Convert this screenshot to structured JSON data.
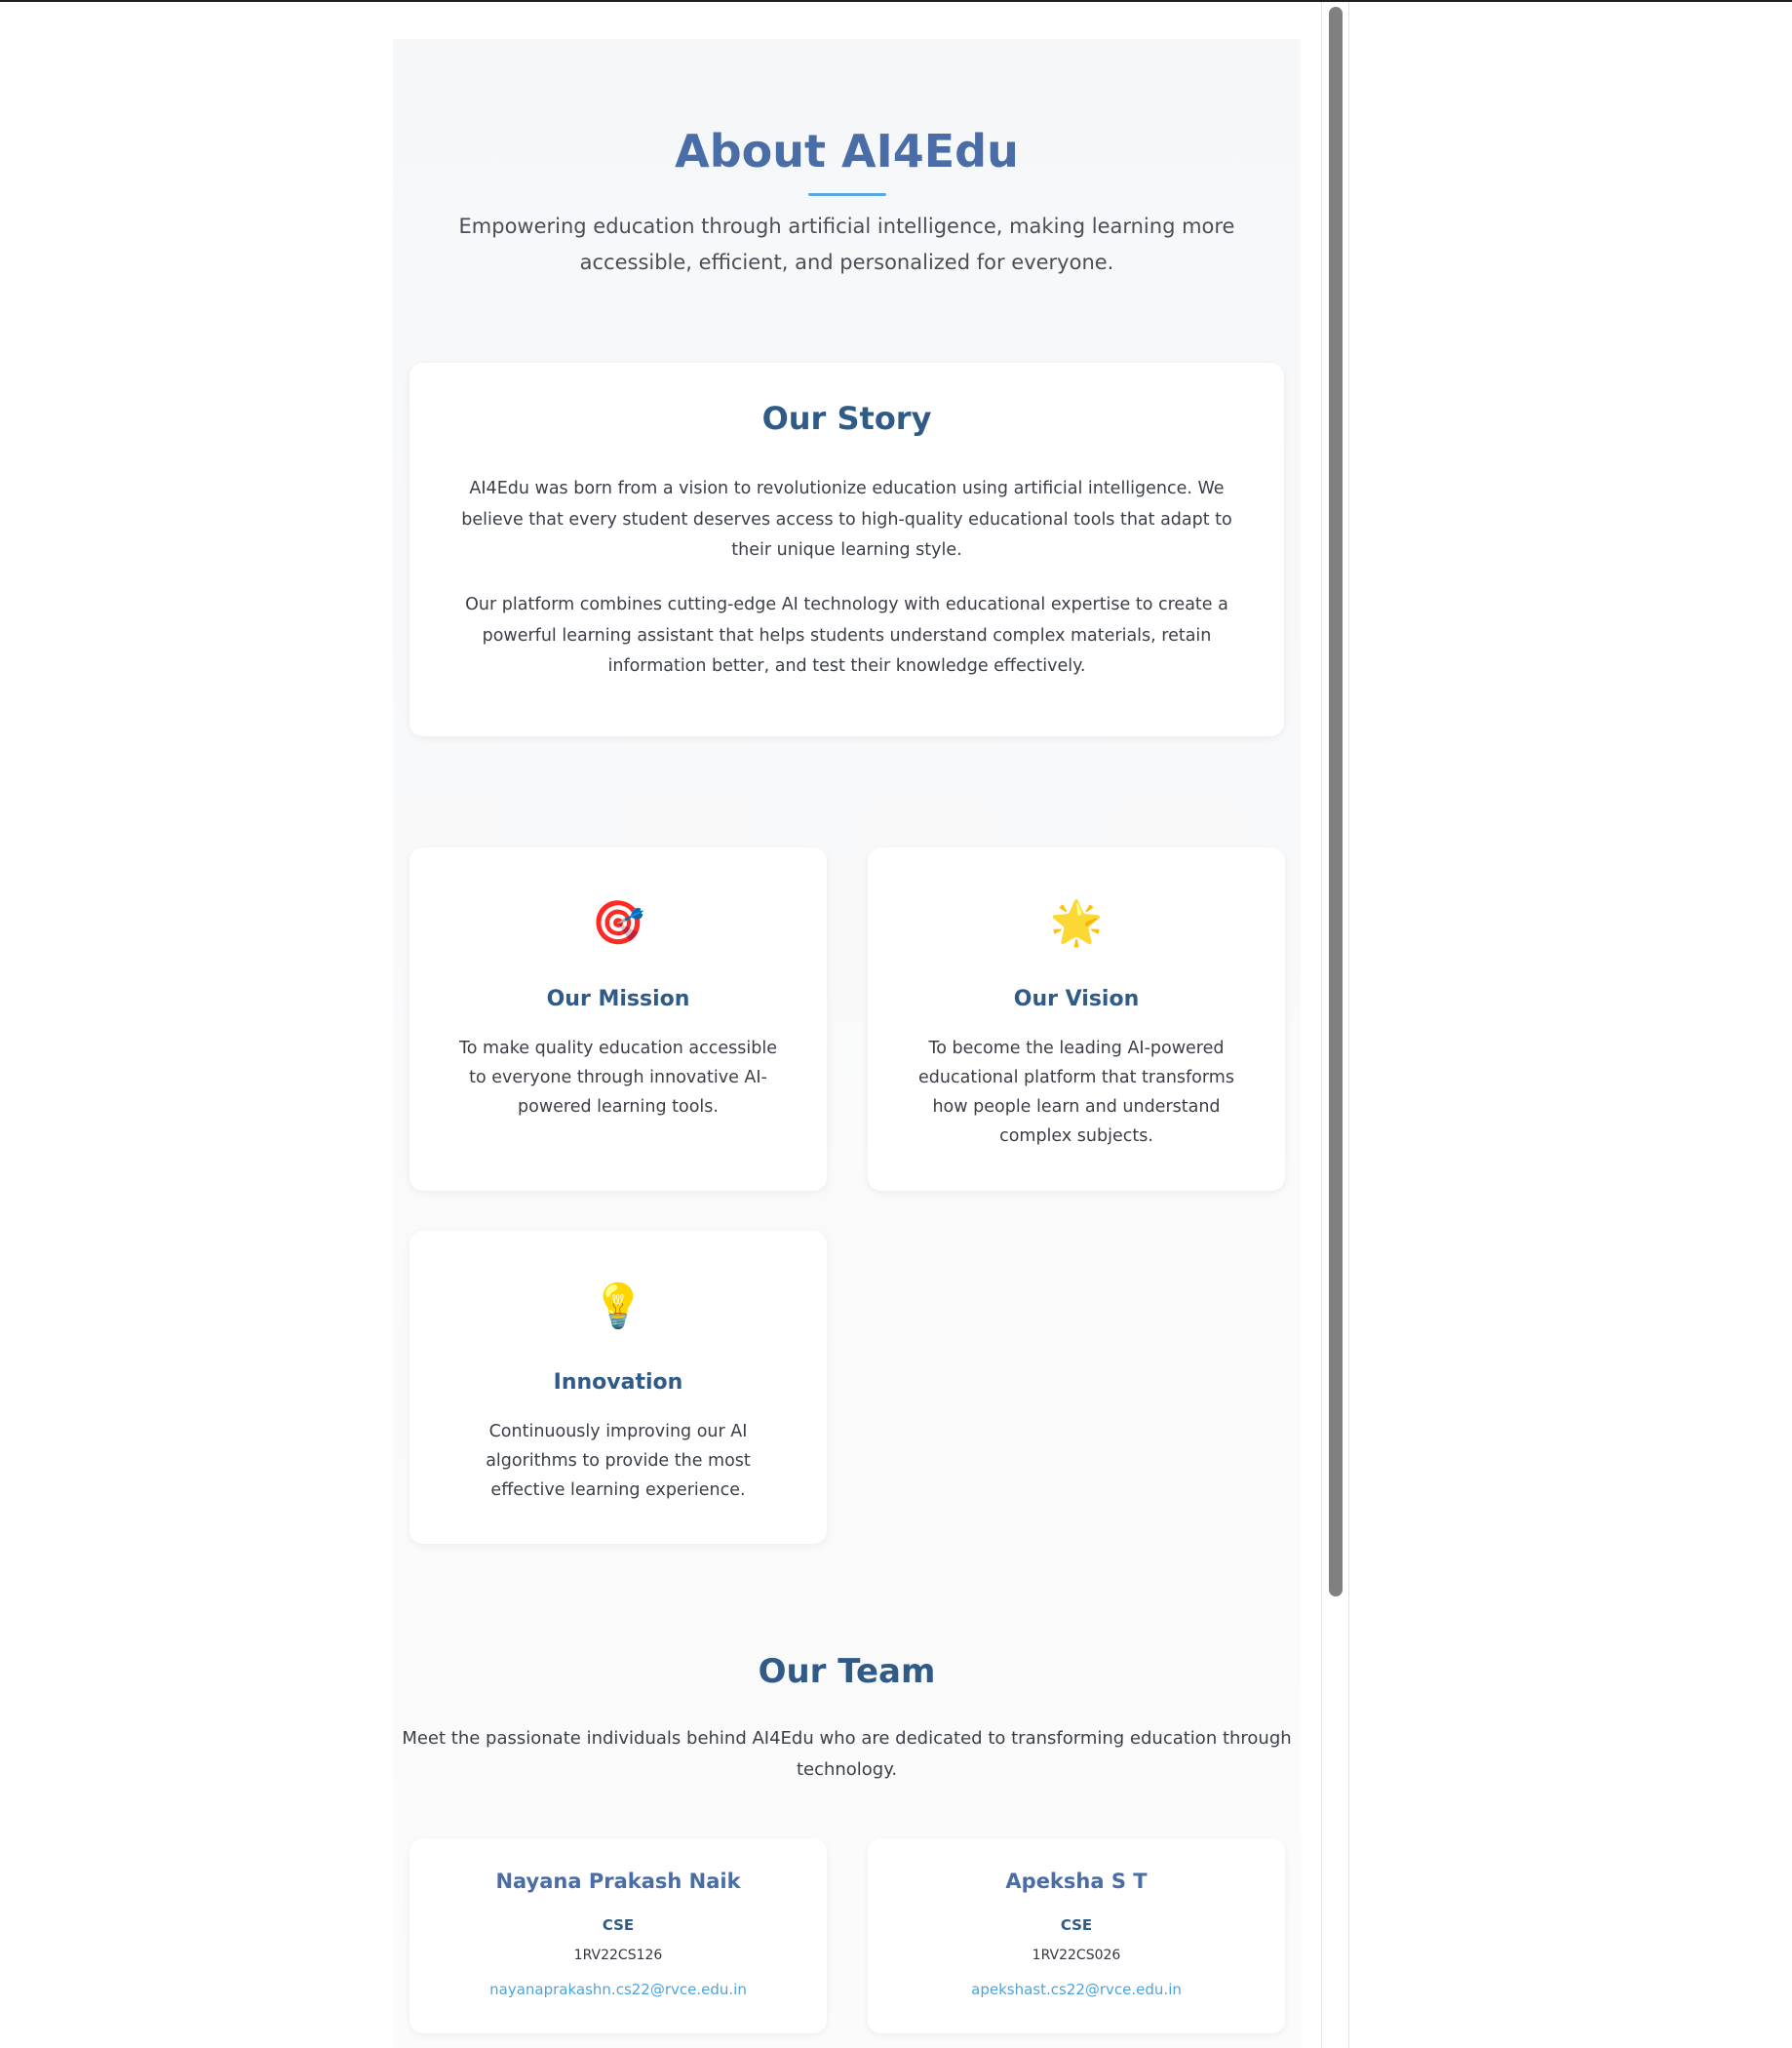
{
  "hero": {
    "title": "About AI4Edu",
    "subtitle": "Empowering education through artificial intelligence, making learning more accessible, efficient, and personalized for everyone."
  },
  "story": {
    "title": "Our Story",
    "paragraphs": [
      "AI4Edu was born from a vision to revolutionize education using artificial intelligence. We believe that every student deserves access to high-quality educational tools that adapt to their unique learning style.",
      "Our platform combines cutting-edge AI technology with educational expertise to create a powerful learning assistant that helps students understand complex materials, retain information better, and test their knowledge effectively."
    ]
  },
  "values": [
    {
      "icon": "🎯",
      "icon_name": "target-icon",
      "title": "Our Mission",
      "description": "To make quality education accessible to everyone through innovative AI-powered learning tools."
    },
    {
      "icon": "🌟",
      "icon_name": "star-icon",
      "title": "Our Vision",
      "description": "To become the leading AI-powered educational platform that transforms how people learn and understand complex subjects."
    },
    {
      "icon": "💡",
      "icon_name": "lightbulb-icon",
      "title": "Innovation",
      "description": "Continuously improving our AI algorithms to provide the most effective learning experience."
    }
  ],
  "team": {
    "title": "Our Team",
    "subtitle": "Meet the passionate individuals behind AI4Edu who are dedicated to transforming education through technology.",
    "members": [
      {
        "name": "Nayana Prakash Naik",
        "department": "CSE",
        "usn": "1RV22CS126",
        "email": "nayanaprakashn.cs22@rvce.edu.in"
      },
      {
        "name": "Apeksha S T",
        "department": "CSE",
        "usn": "1RV22CS026",
        "email": "apekshast.cs22@rvce.edu.in"
      }
    ]
  },
  "colors": {
    "heading_primary": "#4a6da7",
    "heading_secondary": "#2f5b86",
    "accent": "#5aaadf",
    "link": "#4da3dd",
    "body_text": "#3a3f47",
    "page_background": "#f6f7f9",
    "card_background": "#ffffff"
  }
}
